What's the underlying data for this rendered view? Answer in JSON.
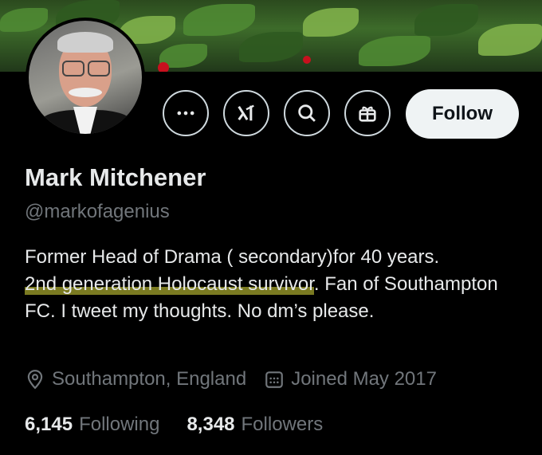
{
  "profile": {
    "name": "Mark Mitchener",
    "handle": "@markofagenius",
    "bio_part1": "Former Head of Drama ( secondary)for 40 years.",
    "bio_highlight": "2nd generation  Holocaust survivor",
    "bio_part2": ". Fan of Southampton FC. I tweet my thoughts. No dm’s please.",
    "location": "Southampton, England",
    "joined": "Joined May 2017",
    "following_count": "6,145",
    "following_label": "Following",
    "followers_count": "8,348",
    "followers_label": "Followers"
  },
  "actions": {
    "more_icon": "more-icon",
    "grok_icon": "grok-icon",
    "search_icon": "search-icon",
    "gift_icon": "gift-icon",
    "follow_label": "Follow"
  },
  "colors": {
    "background": "#000000",
    "primary_text": "#e7e9ea",
    "secondary_text": "#71767b",
    "follow_bg": "#eff3f4",
    "highlight": "#dede3c"
  }
}
